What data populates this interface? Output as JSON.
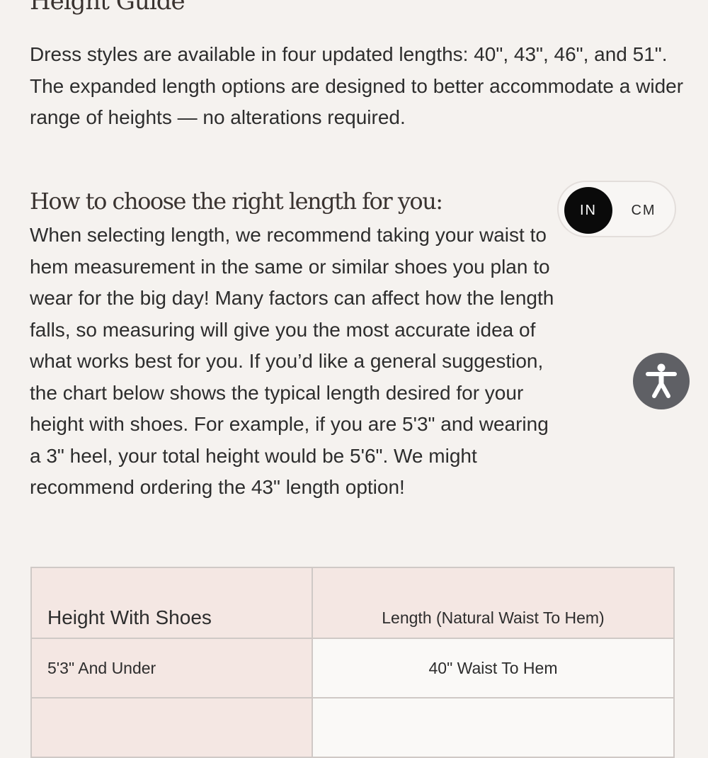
{
  "page": {
    "title": "Height Guide",
    "intro": "Dress styles are available in four updated lengths: 40\", 43\", 46\", and 51\". The expanded length options are designed to better accommodate a wider range of heights — no alterations required."
  },
  "guide": {
    "heading": "How to choose the right length for you:",
    "body": "When selecting length, we recommend taking your waist to hem measurement in the same or similar shoes you plan to wear for the big day! Many factors can affect how the length falls, so measuring will give you the most accurate idea of what works best for you. If you’d like a general suggestion, the chart below shows the typical length desired for your height with shoes. For example, if you are 5'3\" and wearing a 3\" heel, your total height would be 5'6\". We might recommend ordering the 43\" length option!"
  },
  "unit_toggle": {
    "options": [
      "IN",
      "CM"
    ],
    "selected": "IN"
  },
  "accessibility": {
    "icon": "accessibility-person-icon"
  },
  "size_table": {
    "headers": [
      "Height With Shoes",
      "Length (Natural Waist To Hem)"
    ],
    "rows": [
      [
        "5'3\" And Under",
        "40\" Waist To Hem"
      ],
      [
        "",
        ""
      ]
    ]
  },
  "colors": {
    "background": "#f5f2ef",
    "table_header_bg": "#f4e7e3",
    "table_cell_bg": "#faf9f7",
    "toggle_active_bg": "#0a0a0a",
    "accessibility_bg": "#5f6065"
  }
}
